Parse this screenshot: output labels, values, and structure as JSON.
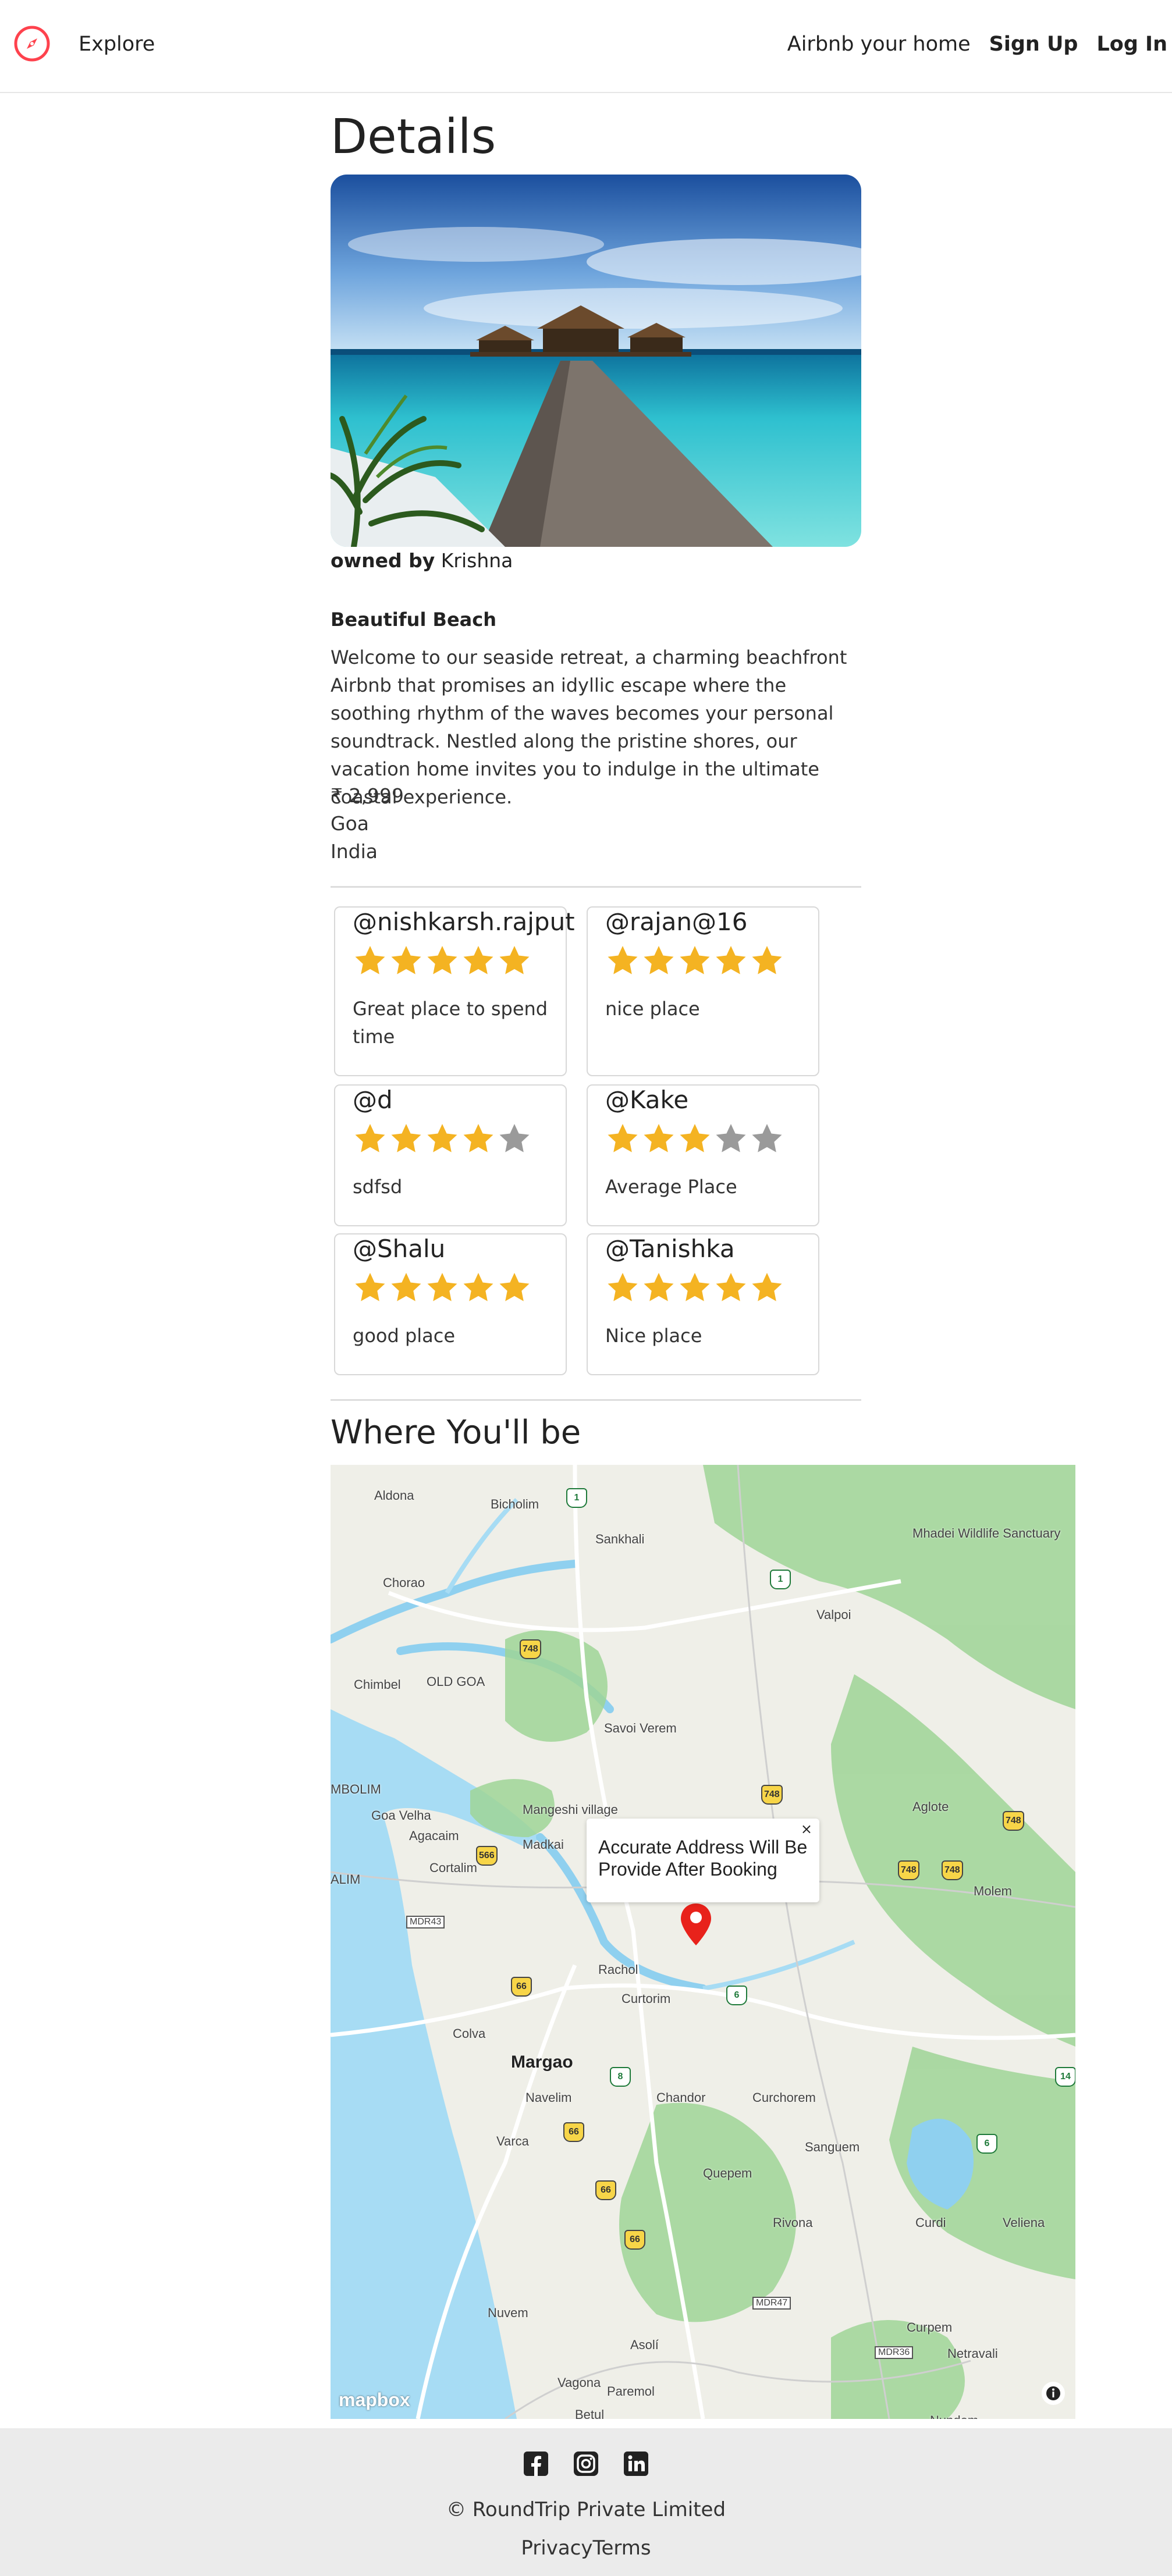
{
  "nav": {
    "explore": "Explore",
    "airbnb_your_home": "Airbnb your home",
    "sign_up": "Sign Up",
    "log_in": "Log In",
    "logo_icon": "compass-icon",
    "accent": "#fe424d"
  },
  "listing": {
    "heading": "Details",
    "owned_by_label": "owned by",
    "owner": "Krishna",
    "title": "Beautiful Beach",
    "description": "Welcome to our seaside retreat, a charming beachfront Airbnb that promises an idyllic escape where the soothing rhythm of the waves becomes your personal soundtrack. Nestled along the pristine shores, our vacation home invites you to indulge in the ultimate coastal experience.",
    "price": "₹ 2,999",
    "location": "Goa",
    "country": "India"
  },
  "reviews": [
    {
      "user": "@nishkarsh.rajput",
      "rating": 5,
      "comment": "Great place to spend time"
    },
    {
      "user": "@rajan@16",
      "rating": 5,
      "comment": "nice place"
    },
    {
      "user": "@d",
      "rating": 4,
      "comment": "sdfsd"
    },
    {
      "user": "@Kake",
      "rating": 3,
      "comment": "Average Place"
    },
    {
      "user": "@Shalu",
      "rating": 5,
      "comment": "good place"
    },
    {
      "user": "@Tanishka",
      "rating": 5,
      "comment": "Nice place"
    }
  ],
  "star_colors": {
    "filled": "#f4b322",
    "empty": "#9a9a9a"
  },
  "map": {
    "heading": "Where You'll be",
    "popup_text": "Accurate Address Will Be Provide After Booking",
    "popup_close": "×",
    "attribution": "mapbox",
    "labels": [
      "Aldona",
      "Bicholim",
      "Sankhali",
      "Mhadei Wildlife Sanctuary",
      "Chorao",
      "Valpoi",
      "Chimbel",
      "OLD GOA",
      "Savoi Verem",
      "MBOLIM",
      "Goa Velha",
      "Mangeshi village",
      "Aglote",
      "Agacaim",
      "Madkai",
      "ALIM",
      "Cortalim",
      "Molem",
      "MDR43",
      "Rachol",
      "Curtorim",
      "Colva",
      "Margao",
      "Navelim",
      "Chandor",
      "Curchorem",
      "Varca",
      "Sanguem",
      "Quepem",
      "Rivona",
      "Curdi",
      "Veliena",
      "Nuvem",
      "Asolí",
      "Curpem",
      "Vagona",
      "Paremol",
      "Netravali",
      "Betul",
      "Nundem",
      "MDR36",
      "MDR47"
    ],
    "route_shields": [
      "1",
      "1",
      "748",
      "748",
      "748",
      "748",
      "748",
      "566",
      "66",
      "66",
      "66",
      "66",
      "6",
      "8",
      "6",
      "14"
    ]
  },
  "footer": {
    "icons": [
      "facebook-icon",
      "instagram-icon",
      "linkedin-icon"
    ],
    "copyright": "© RoundTrip Private Limited",
    "privacy": "Privacy",
    "terms": "Terms"
  }
}
